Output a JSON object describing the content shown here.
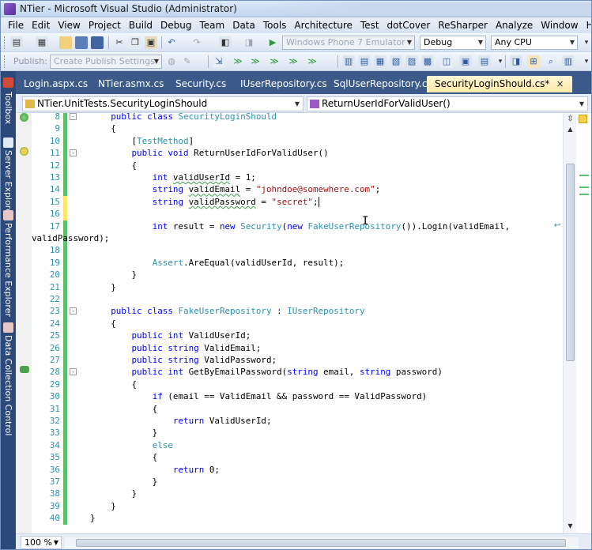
{
  "window": {
    "title": "NTier - Microsoft Visual Studio (Administrator)"
  },
  "menu": [
    "File",
    "Edit",
    "View",
    "Project",
    "Build",
    "Debug",
    "Team",
    "Data",
    "Tools",
    "Architecture",
    "Test",
    "dotCover",
    "ReSharper",
    "Analyze",
    "Window",
    "Help"
  ],
  "toolbar": {
    "target_device": "Windows Phone 7 Emulator",
    "configuration": "Debug",
    "platform": "Any CPU",
    "publish_label": "Publish:",
    "publish_settings": "Create Publish Settings"
  },
  "side_tabs": [
    "Toolbox",
    "Server Explorer",
    "Performance Explorer",
    "Data Collection Control"
  ],
  "doc_tabs": [
    {
      "label": "Login.aspx.cs"
    },
    {
      "label": "NTier.asmx.cs"
    },
    {
      "label": "Security.cs"
    },
    {
      "label": "IUserRepository.cs"
    },
    {
      "label": "SqlUserRepository.cs"
    },
    {
      "label": "SecurityLoginShould.cs*",
      "close": "×"
    }
  ],
  "nav": {
    "type_selector": "NTier.UnitTests.SecurityLoginShould",
    "member_selector": "ReturnUserIdForValidUser()"
  },
  "code": {
    "line_numbers": [
      "8",
      "9",
      "10",
      "11",
      "12",
      "13",
      "14",
      "15",
      "16",
      "17",
      "",
      "18",
      "19",
      "20",
      "21",
      "22",
      "23",
      "24",
      "25",
      "26",
      "27",
      "28",
      "29",
      "30",
      "31",
      "32",
      "33",
      "34",
      "35",
      "36",
      "37",
      "38",
      "39",
      "40"
    ],
    "lines": [
      [
        {
          "t": "    "
        },
        {
          "k": "kw",
          "t": "public class"
        },
        {
          "t": " "
        },
        {
          "k": "tp",
          "t": "SecurityLoginShould"
        }
      ],
      [
        {
          "t": "    {"
        }
      ],
      [
        {
          "t": "        ["
        },
        {
          "k": "tp",
          "t": "TestMethod"
        },
        {
          "t": "]"
        }
      ],
      [
        {
          "t": "        "
        },
        {
          "k": "kw",
          "t": "public void"
        },
        {
          "t": " ReturnUserIdForValidUser()"
        }
      ],
      [
        {
          "t": "        {"
        }
      ],
      [
        {
          "t": "            "
        },
        {
          "k": "kw",
          "t": "int"
        },
        {
          "t": " "
        },
        {
          "k": "sq",
          "t": "validUserId"
        },
        {
          "t": " = 1;"
        }
      ],
      [
        {
          "t": "            "
        },
        {
          "k": "kw",
          "t": "string"
        },
        {
          "t": " "
        },
        {
          "k": "sq",
          "t": "validEmail"
        },
        {
          "t": " = "
        },
        {
          "k": "st",
          "t": "\"johndoe@somewhere.com\""
        },
        {
          "t": ";"
        }
      ],
      [
        {
          "t": "            "
        },
        {
          "k": "kw",
          "t": "string"
        },
        {
          "t": " "
        },
        {
          "k": "sq",
          "t": "validPassword"
        },
        {
          "t": " = "
        },
        {
          "k": "st",
          "t": "\"secret\""
        },
        {
          "t": ";"
        },
        {
          "k": "cur",
          "t": ""
        }
      ],
      [
        {
          "t": ""
        }
      ],
      [
        {
          "t": "            "
        },
        {
          "k": "kw",
          "t": "int"
        },
        {
          "t": " result = "
        },
        {
          "k": "kw",
          "t": "new"
        },
        {
          "t": " "
        },
        {
          "k": "tp",
          "t": "Security"
        },
        {
          "t": "("
        },
        {
          "k": "kw",
          "t": "new"
        },
        {
          "t": " "
        },
        {
          "k": "tp",
          "t": "FakeUserRepository"
        },
        {
          "t": "()).Login(validEmail,"
        }
      ],
      [
        {
          "x": "wrap",
          "t": "validPassword);"
        }
      ],
      [
        {
          "t": ""
        }
      ],
      [
        {
          "t": "            "
        },
        {
          "k": "tp",
          "t": "Assert"
        },
        {
          "t": ".AreEqual(validUserId, result);"
        }
      ],
      [
        {
          "t": "        }"
        }
      ],
      [
        {
          "t": "    }"
        }
      ],
      [
        {
          "t": ""
        }
      ],
      [
        {
          "t": "    "
        },
        {
          "k": "kw",
          "t": "public class"
        },
        {
          "t": " "
        },
        {
          "k": "tp",
          "t": "FakeUserRepository"
        },
        {
          "t": " : "
        },
        {
          "k": "tp",
          "t": "IUserRepository"
        }
      ],
      [
        {
          "t": "    {"
        }
      ],
      [
        {
          "t": "        "
        },
        {
          "k": "kw",
          "t": "public int"
        },
        {
          "t": " ValidUserId;"
        }
      ],
      [
        {
          "t": "        "
        },
        {
          "k": "kw",
          "t": "public string"
        },
        {
          "t": " ValidEmail;"
        }
      ],
      [
        {
          "t": "        "
        },
        {
          "k": "kw",
          "t": "public string"
        },
        {
          "t": " ValidPassword;"
        }
      ],
      [
        {
          "t": "        "
        },
        {
          "k": "kw",
          "t": "public int"
        },
        {
          "t": " GetByEmailPassword("
        },
        {
          "k": "kw",
          "t": "string"
        },
        {
          "t": " email, "
        },
        {
          "k": "kw",
          "t": "string"
        },
        {
          "t": " password)"
        }
      ],
      [
        {
          "t": "        {"
        }
      ],
      [
        {
          "t": "            "
        },
        {
          "k": "kw",
          "t": "if"
        },
        {
          "t": " (email == ValidEmail && password == ValidPassword)"
        }
      ],
      [
        {
          "t": "            {"
        }
      ],
      [
        {
          "t": "                "
        },
        {
          "k": "kw",
          "t": "return"
        },
        {
          "t": " ValidUserId;"
        }
      ],
      [
        {
          "t": "            }"
        }
      ],
      [
        {
          "t": "            "
        },
        {
          "k": "tp",
          "t": "else"
        }
      ],
      [
        {
          "t": "            {"
        }
      ],
      [
        {
          "t": "                "
        },
        {
          "k": "kw",
          "t": "return"
        },
        {
          "t": " 0;"
        }
      ],
      [
        {
          "t": "            }"
        }
      ],
      [
        {
          "t": "        }"
        }
      ],
      [
        {
          "t": "    }"
        }
      ],
      [
        {
          "t": "}"
        }
      ]
    ]
  },
  "zoom": "100 %",
  "colors": {
    "keyword": "#0000ff",
    "type": "#2b91af",
    "string": "#a31515",
    "line_number": "#2b91af",
    "saved_change": "#5fc06b",
    "unsaved_change": "#ffe76a",
    "active_tab": "#ffe8a8",
    "chrome_dark": "#2b4a7a"
  }
}
